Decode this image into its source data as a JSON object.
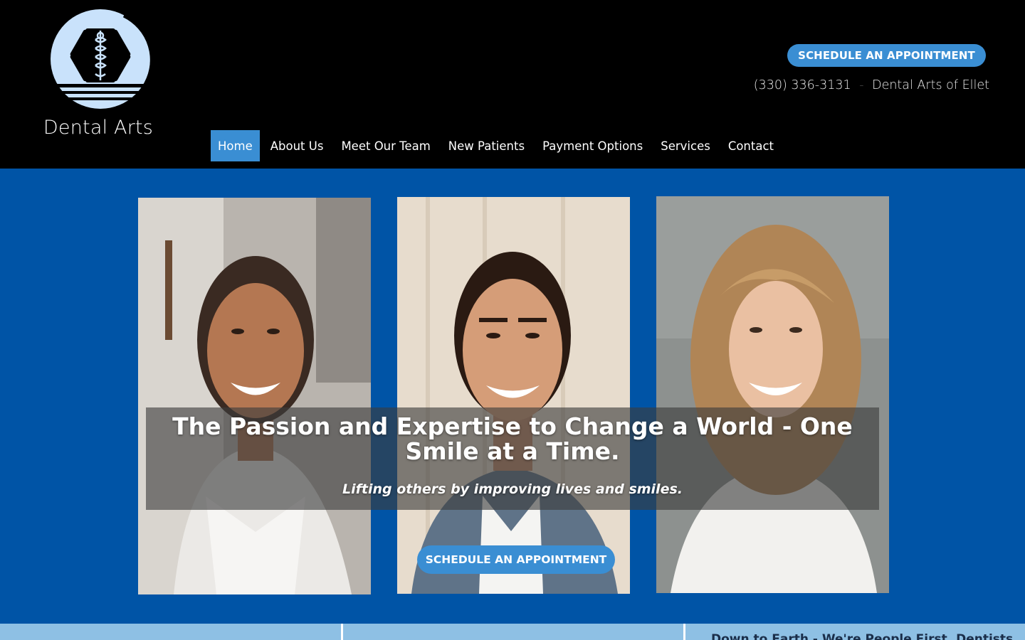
{
  "brand": {
    "name": "Dental Arts",
    "logo_icon": "star-of-life-caduceus-icon"
  },
  "header": {
    "cta_label": "SCHEDULE AN APPOINTMENT",
    "phone": "(330) 336-3131",
    "separator": "-",
    "location": "Dental Arts of Ellet"
  },
  "nav": {
    "items": [
      {
        "label": "Home",
        "active": true
      },
      {
        "label": "About Us"
      },
      {
        "label": "Meet Our Team"
      },
      {
        "label": "New Patients"
      },
      {
        "label": "Payment Options"
      },
      {
        "label": "Services"
      },
      {
        "label": "Contact"
      }
    ]
  },
  "hero": {
    "headline": "The Passion and Expertise to Change a World - One Smile at a Time.",
    "subline": "Lifting others by improving lives and smiles.",
    "cta_label": "SCHEDULE AN APPOINTMENT"
  },
  "strip": {
    "col3_text": "Down to Earth - We're People First, Dentists"
  },
  "colors": {
    "header_bg": "#000000",
    "hero_bg": "#0054a6",
    "accent": "#3a8ed3",
    "logo_fill": "#c9e2fb",
    "strip_bg": "#8ec0e4"
  }
}
